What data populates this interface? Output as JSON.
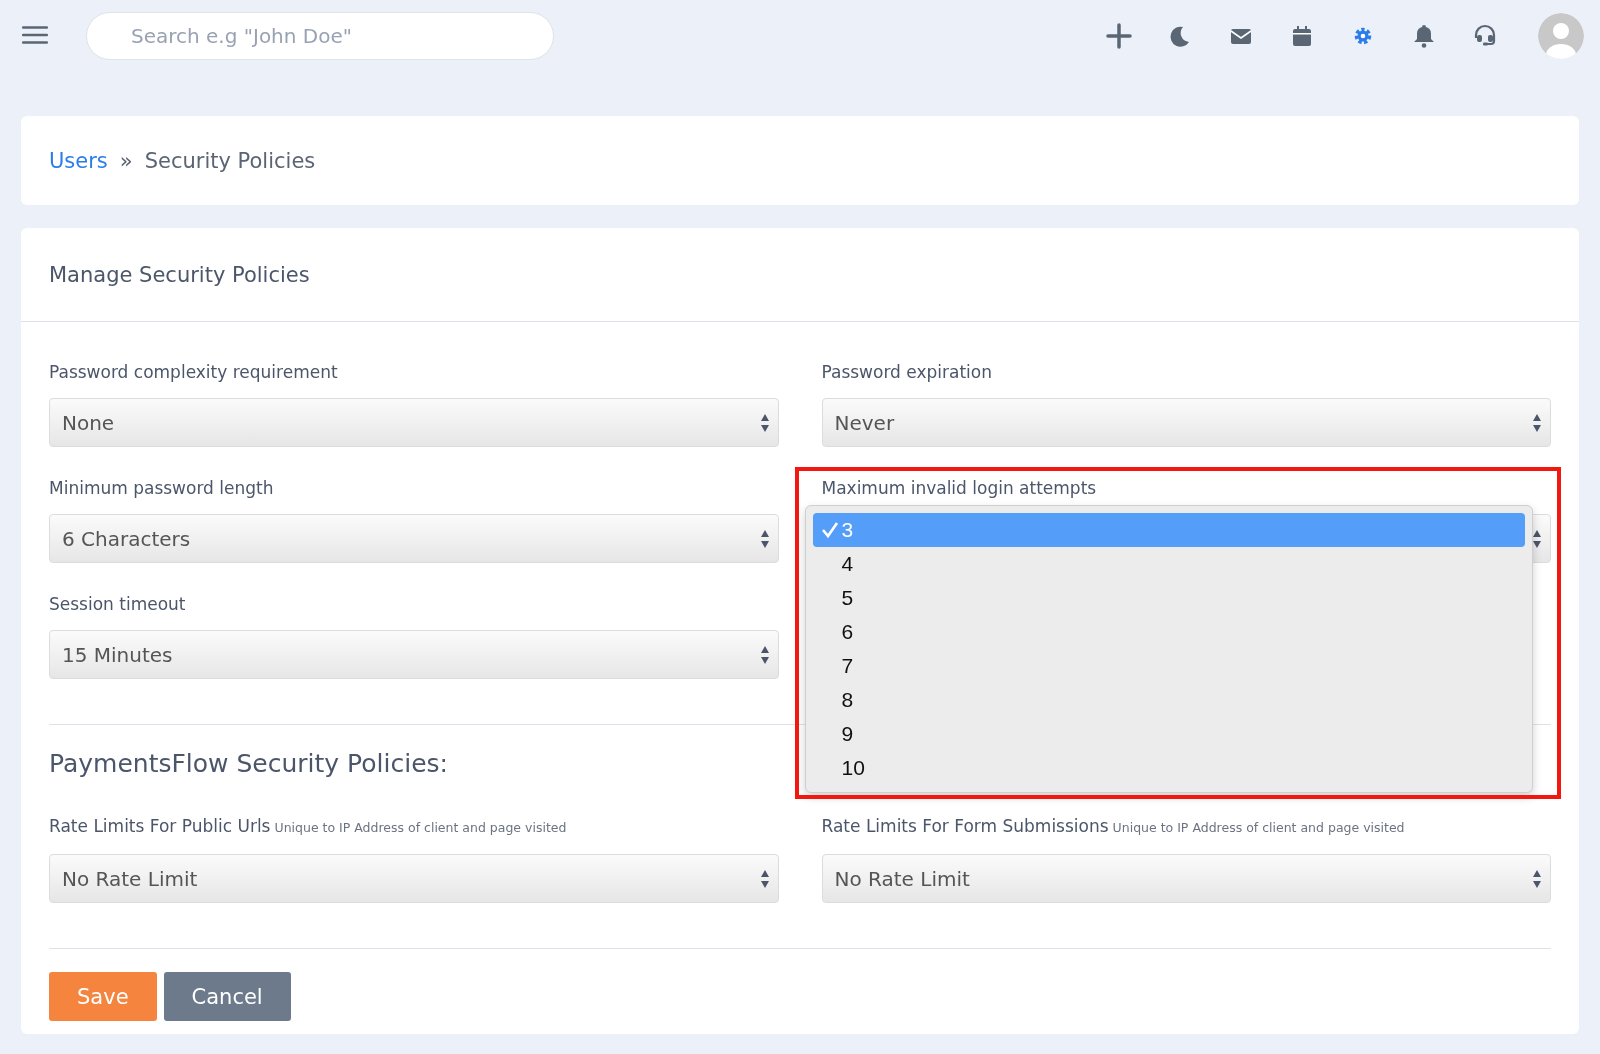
{
  "topbar": {
    "search": {
      "placeholder": "Search e.g \"John Doe\""
    }
  },
  "breadcrumb": {
    "items": [
      "Users",
      "Security Policies"
    ],
    "separator": "»"
  },
  "card": {
    "title": "Manage Security Policies",
    "rows": [
      {
        "fields": [
          {
            "kind": "select",
            "label": "Password complexity requirement",
            "value": "None"
          },
          {
            "kind": "select",
            "label": "Password expiration",
            "value": "Never"
          }
        ]
      },
      {
        "fields": [
          {
            "kind": "select",
            "label": "Minimum password length",
            "value": "6 Characters"
          },
          {
            "kind": "open_select",
            "label": "Maximum invalid login attempts",
            "highlighted": true,
            "options": [
              {
                "label": "3",
                "selected": true
              },
              {
                "label": "4",
                "selected": false
              },
              {
                "label": "5",
                "selected": false
              },
              {
                "label": "6",
                "selected": false
              },
              {
                "label": "7",
                "selected": false
              },
              {
                "label": "8",
                "selected": false
              },
              {
                "label": "9",
                "selected": false
              },
              {
                "label": "10",
                "selected": false
              }
            ]
          }
        ]
      },
      {
        "fields": [
          {
            "kind": "select",
            "label": "Session timeout",
            "value": "15 Minutes"
          }
        ]
      }
    ],
    "section": {
      "title": "PaymentsFlow Security Policies:",
      "fields": [
        {
          "kind": "select",
          "label": "Rate Limits For Public Urls",
          "hint": "Unique to IP Address of client and page visited",
          "value": "No Rate Limit"
        },
        {
          "kind": "select",
          "label": "Rate Limits For Form Submissions",
          "hint": "Unique to IP Address of client and page visited",
          "value": "No Rate Limit"
        }
      ]
    },
    "buttons": [
      {
        "kind": "primary",
        "label": "Save"
      },
      {
        "kind": "secondary",
        "label": "Cancel"
      }
    ]
  }
}
